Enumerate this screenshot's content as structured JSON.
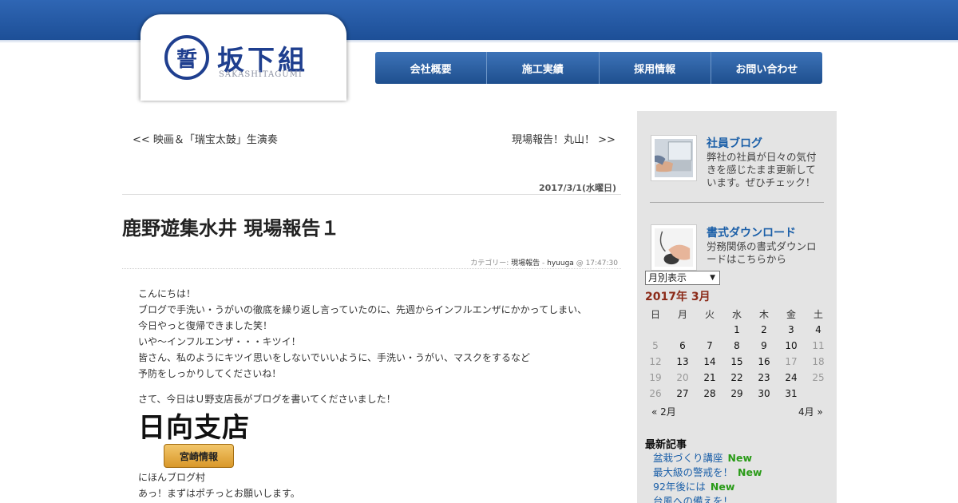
{
  "header": {
    "logo_mark": "誓",
    "logo_text": "坂下組",
    "logo_sub": "SAKASHITAGUMI",
    "nav": [
      "会社概要",
      "施工実績",
      "採用情報",
      "お問い合わせ"
    ]
  },
  "post": {
    "prev": "<< 映画＆「瑞宝太鼓」生演奏",
    "next": "現場報告！丸山！ >>",
    "date": "2017/3/1(水曜日)",
    "title": "鹿野遊集水井 現場報告１",
    "meta_category_label": "カテゴリー:",
    "meta_category": "現場報告",
    "meta_sep": "-",
    "meta_author": "hyuuga",
    "meta_time": "@ 17:47:30",
    "body_lines": [
      "こんにちは！",
      "ブログで手洗い・うがいの徹底を繰り返し言っていたのに、先週からインフルエンザにかかってしまい、",
      "今日やっと復帰できました笑！",
      "いや～インフルエンザ・・・キツイ！",
      "皆さん、私のようにキツイ思いをしないでいいように、手洗い・うがい、マスクをするなど",
      "予防をしっかりしてくださいね！"
    ],
    "body_line2": "さて、今日はＵ野支店長がブログを書いてくださいました！",
    "banner_title": "日向支店",
    "banner_badge": "宮崎情報",
    "banner_caption": "にほんブログ村",
    "body_tail": "あっ！まずはポチっとお願いします。"
  },
  "sidebar": {
    "promo1": {
      "title": "社員ブログ",
      "desc": "弊社の社員が日々の気付きを感じたまま更新しています。ぜひチェック！"
    },
    "promo2": {
      "title": "書式ダウンロード",
      "desc": "労務関係の書式ダウンロードはこちらから"
    },
    "month_select": "月別表示",
    "calendar": {
      "caption": "2017年 3月",
      "weekdays": [
        "日",
        "月",
        "火",
        "水",
        "木",
        "金",
        "土"
      ],
      "prev": "« 2月",
      "next": "4月 »"
    },
    "recent": {
      "title": "最新記事",
      "items": [
        {
          "label": "盆栽づくり講座",
          "badge": "New"
        },
        {
          "label": "最大級の警戒を！",
          "badge": "New"
        },
        {
          "label": "92年後には",
          "badge": "New"
        },
        {
          "label": "台風への備えを！",
          "badge": ""
        }
      ]
    }
  },
  "colors": {
    "brand_blue": "#1f3f8f",
    "nav_blue": "#2a5d9e",
    "link_blue": "#1b5fa8",
    "new_green": "#2a9b18",
    "calendar_caption": "#8b2a18"
  }
}
